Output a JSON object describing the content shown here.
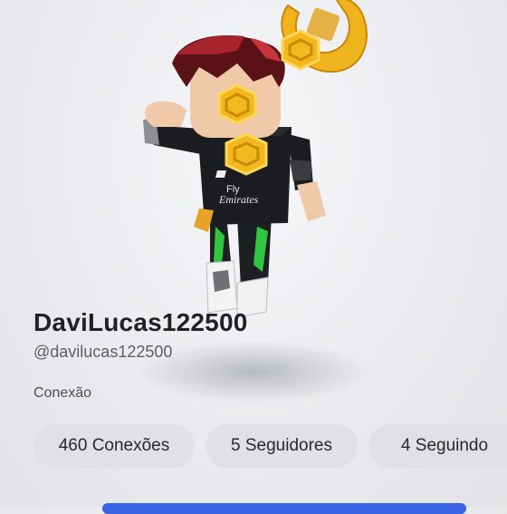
{
  "profile": {
    "display_name": "DaviLucas122500",
    "handle": "@davilucas122500",
    "status": "Conexão"
  },
  "stats": [
    {
      "label": "460 Conexões"
    },
    {
      "label": "5 Seguidores"
    },
    {
      "label": "4 Seguindo"
    }
  ],
  "avatar": {
    "shirt_text_line1": "Fly",
    "shirt_text_line2": "Emirates"
  },
  "colors": {
    "accent_blue": "#3b63e6",
    "pill_bg": "#dfe1e4",
    "gold": "#f2b51c"
  },
  "icons": [
    "avatar-3d",
    "gold-ring-accessory"
  ]
}
